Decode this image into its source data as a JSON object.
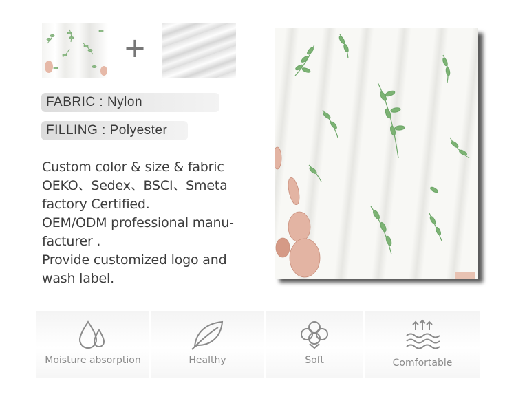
{
  "materials": {
    "fabric_label": "FABRIC : Nylon",
    "filling_label": "FILLING : Polyester",
    "plus_symbol": "+"
  },
  "description": {
    "lines": [
      "Custom color & size & fabric",
      "OEKO、Sedex、BSCI、Smeta",
      "factory Certified.",
      "OEM/ODM professional manu-",
      "facturer .",
      "Provide customized logo and",
      "wash label."
    ]
  },
  "features": [
    {
      "label": "Moisture absorption",
      "icon": "water-drops-icon"
    },
    {
      "label": "Healthy",
      "icon": "leaf-icon"
    },
    {
      "label": "Soft",
      "icon": "cotton-icon"
    },
    {
      "label": "Comfortable",
      "icon": "waves-arrows-icon"
    }
  ],
  "colors": {
    "leaf_green": "#6fa86a",
    "bunny_pink": "#e3b4a3",
    "icon_gray": "#8a8a8a",
    "text_dark": "#3d3d3d"
  }
}
